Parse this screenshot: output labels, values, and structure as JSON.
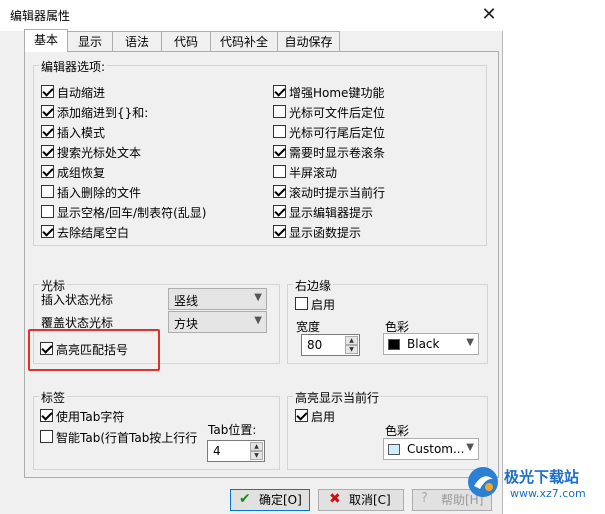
{
  "dialog": {
    "title": "编辑器属性",
    "close_glyph": "✕"
  },
  "tabs": [
    "基本",
    "显示",
    "语法",
    "代码",
    "代码补全",
    "自动保存"
  ],
  "editor_options": {
    "title": "编辑器选项:",
    "left": [
      {
        "label": "自动缩进",
        "checked": true
      },
      {
        "label": "添加缩进到{}和:",
        "checked": true
      },
      {
        "label": "插入模式",
        "checked": true
      },
      {
        "label": "搜索光标处文本",
        "checked": true
      },
      {
        "label": "成组恢复",
        "checked": true
      },
      {
        "label": "插入删除的文件",
        "checked": false
      },
      {
        "label": "显示空格/回车/制表符(乱显)",
        "checked": false
      },
      {
        "label": "去除结尾空白",
        "checked": true
      }
    ],
    "right": [
      {
        "label": "增强Home键功能",
        "checked": true
      },
      {
        "label": "光标可文件后定位",
        "checked": false
      },
      {
        "label": "光标可行尾后定位",
        "checked": false
      },
      {
        "label": "需要时显示卷滚条",
        "checked": true
      },
      {
        "label": "半屏滚动",
        "checked": false
      },
      {
        "label": "滚动时提示当前行",
        "checked": true
      },
      {
        "label": "显示编辑器提示",
        "checked": true
      },
      {
        "label": "显示函数提示",
        "checked": true
      }
    ]
  },
  "cursor": {
    "title": "光标",
    "insert_label": "插入状态光标",
    "insert_value": "竖线",
    "overwrite_label": "覆盖状态光标",
    "overwrite_value": "方块",
    "highlight_brackets_label": "高亮匹配括号",
    "highlight_brackets_checked": true
  },
  "right_margin": {
    "title": "右边缘",
    "enable_label": "启用",
    "enable_checked": false,
    "width_label": "宽度",
    "width_value": "80",
    "color_label": "色彩",
    "color_value": "Black",
    "color_swatch": "#000000"
  },
  "tabs_group": {
    "title": "标签",
    "use_tab_label": "使用Tab字符",
    "use_tab_checked": true,
    "smart_tab_label": "智能Tab(行首Tab按上行行",
    "smart_tab_checked": false,
    "tab_pos_label": "Tab位置:",
    "tab_pos_value": "4"
  },
  "current_line": {
    "title": "高亮显示当前行",
    "enable_label": "启用",
    "enable_checked": true,
    "color_label": "色彩",
    "color_value": "Custom...",
    "color_swatch": "#ccf0ff"
  },
  "buttons": {
    "ok": "确定[O]",
    "cancel": "取消[C]",
    "help": "帮助[H]"
  },
  "watermark": {
    "brand": "极光下载站",
    "url": "www.xz7.com"
  },
  "colors": {
    "highlight_border": "#e03131",
    "ok_check": "#1c8a1c",
    "cancel_x": "#cc1111"
  }
}
